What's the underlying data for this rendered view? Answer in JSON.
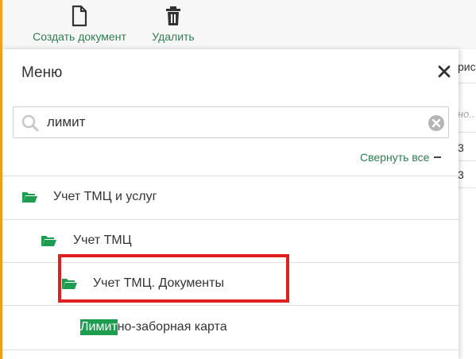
{
  "toolbar": {
    "create_label": "Создать документ",
    "delete_label": "Удалить"
  },
  "background_grid": {
    "cells": [
      "рис",
      "но..",
      "3",
      "3"
    ]
  },
  "menu": {
    "title": "Меню",
    "search": {
      "value": "лимит",
      "placeholder": ""
    },
    "collapse_all_label": "Свернуть все",
    "tree": [
      {
        "label": "Учет ТМЦ и услуг",
        "level": 0,
        "icon": "open-folder-icon"
      },
      {
        "label": "Учет ТМЦ",
        "level": 1,
        "icon": "open-folder-icon"
      },
      {
        "label": "Учет ТМЦ. Документы",
        "level": 2,
        "icon": "open-folder-icon"
      }
    ],
    "leaf": {
      "match": "Лимит",
      "rest": "но-заборная карта"
    }
  },
  "colors": {
    "accent_green": "#2e7d4f",
    "highlight_green": "#1e9c4f",
    "folder_green": "#1e9c4f",
    "annotation_red": "#e02020",
    "left_accent_orange": "#f3a21b"
  }
}
